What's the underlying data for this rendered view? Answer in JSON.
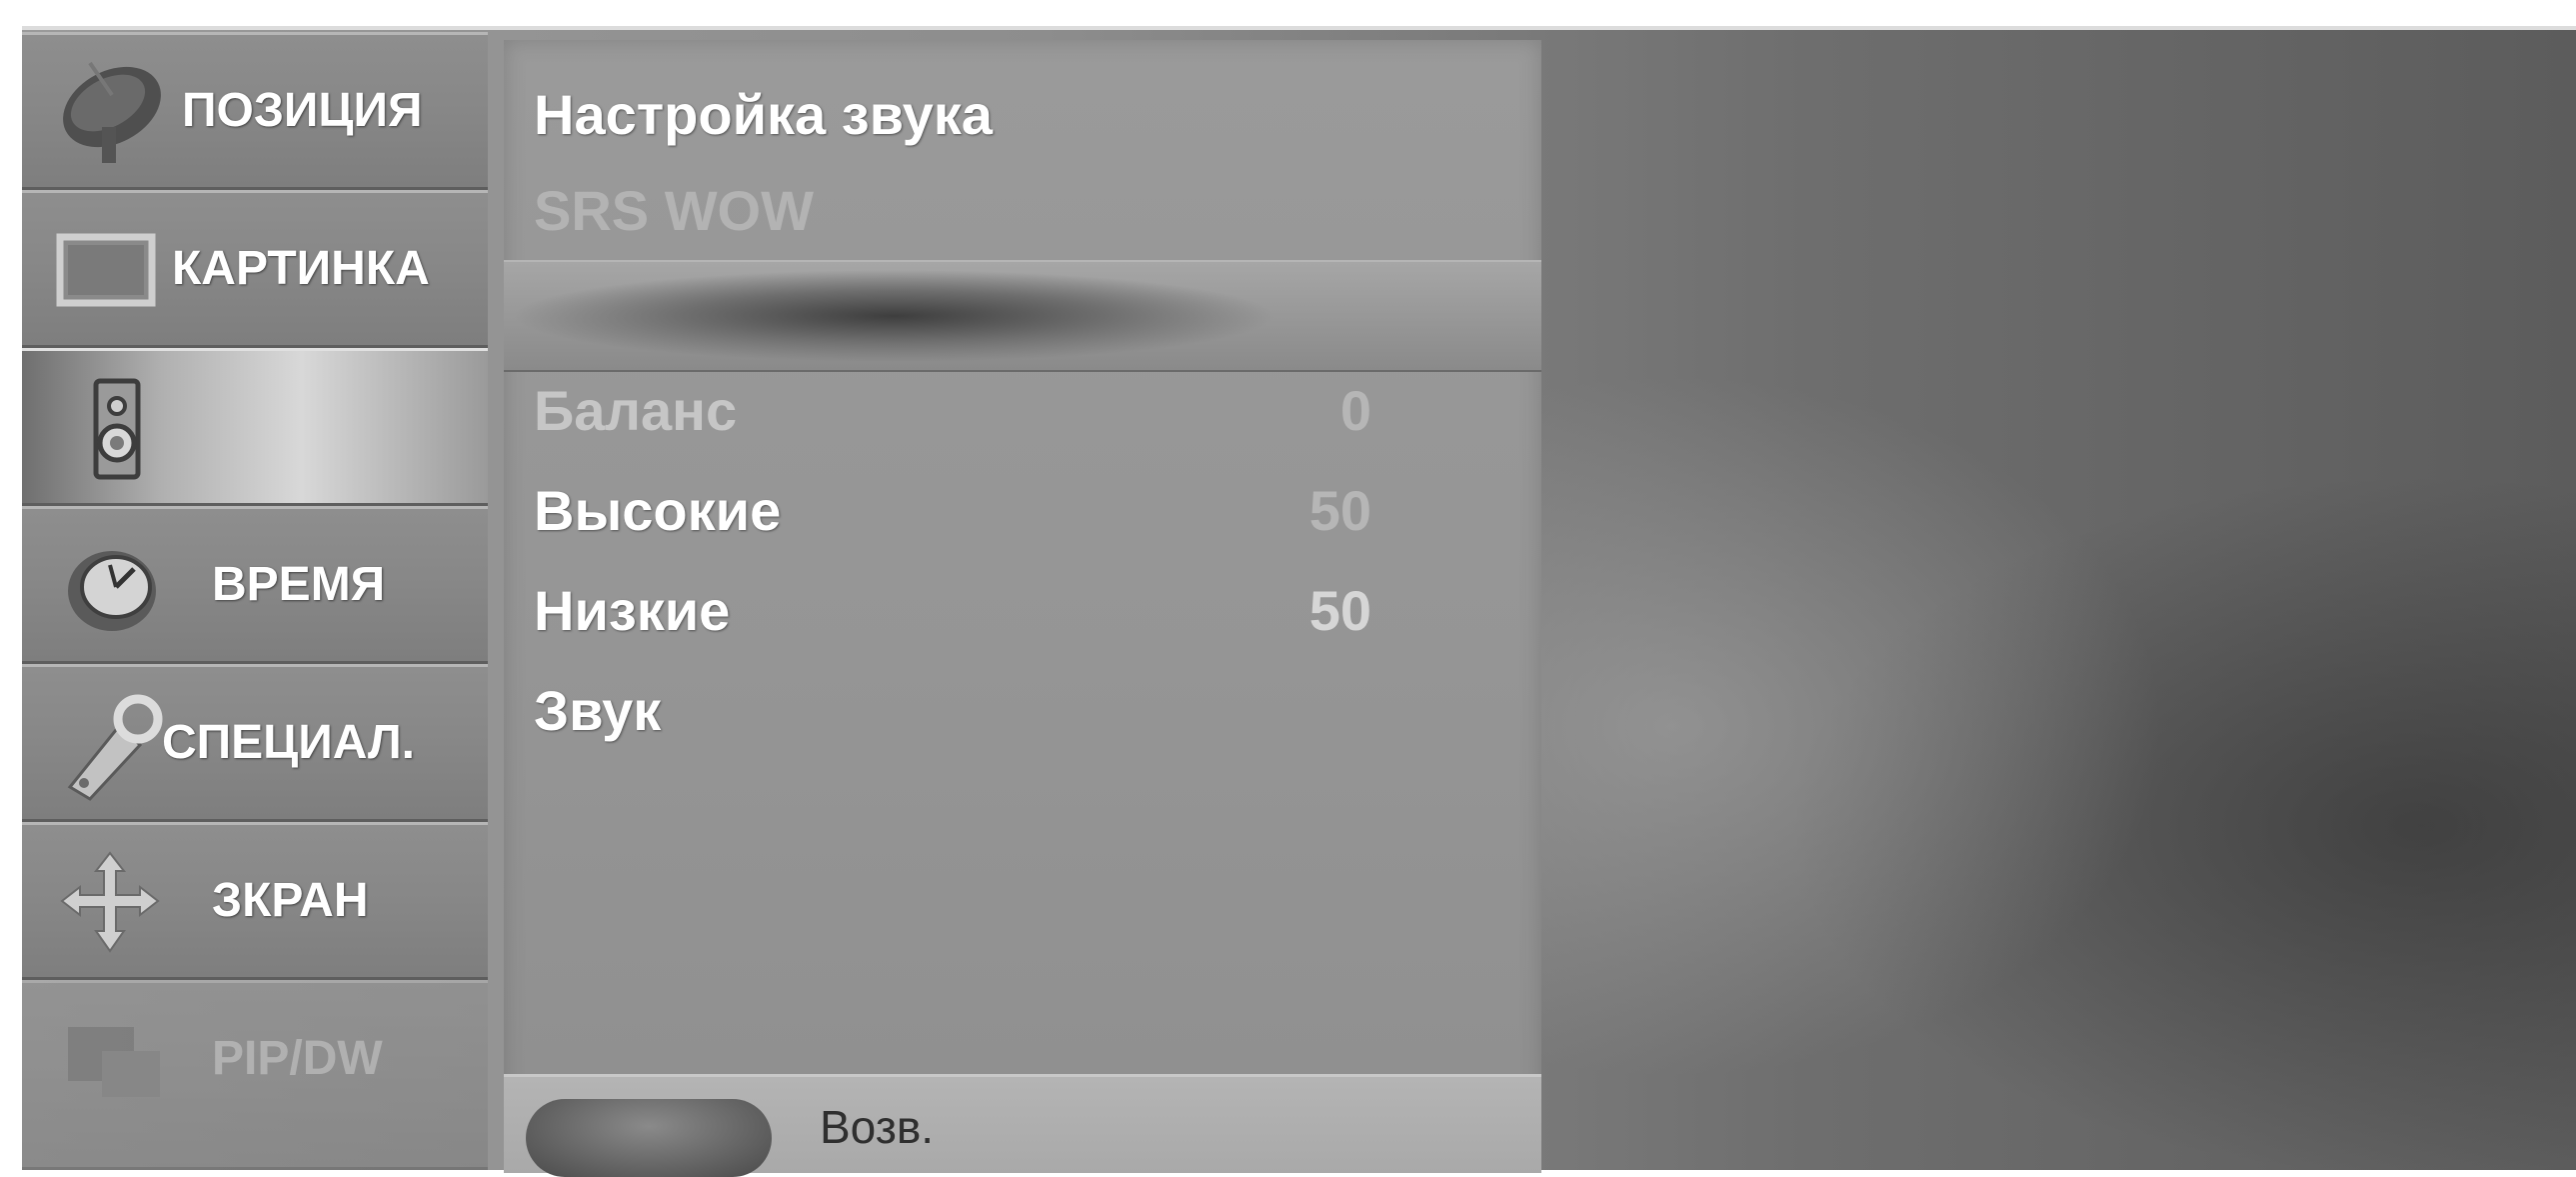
{
  "sidebar": {
    "items": [
      {
        "label": "ПОЗИЦИЯ",
        "icon": "satellite-dish-icon",
        "active": false
      },
      {
        "label": "КАРТИНКА",
        "icon": "tv-screen-icon",
        "active": false
      },
      {
        "label": "",
        "icon": "speaker-icon",
        "active": true
      },
      {
        "label": "ВРЕМЯ",
        "icon": "clock-icon",
        "active": false
      },
      {
        "label": "СПЕЦИАЛ.",
        "icon": "key-tag-icon",
        "active": false
      },
      {
        "label": "ЗКРАН",
        "icon": "move-arrows-icon",
        "active": false
      },
      {
        "label": "PIP/DW",
        "icon": "pip-icon",
        "active": false,
        "dimmed": true
      }
    ]
  },
  "menu": {
    "title": "Настройка звука",
    "items": [
      {
        "label": "SRS WOW",
        "value": ""
      },
      {
        "label": "",
        "value": "",
        "selected": true
      },
      {
        "label": "Баланс",
        "value": "0"
      },
      {
        "label": "Высокие",
        "value": "50"
      },
      {
        "label": "Низкие",
        "value": "50"
      },
      {
        "label": "Звук",
        "value": ""
      }
    ]
  },
  "footer": {
    "label": "Возв."
  }
}
